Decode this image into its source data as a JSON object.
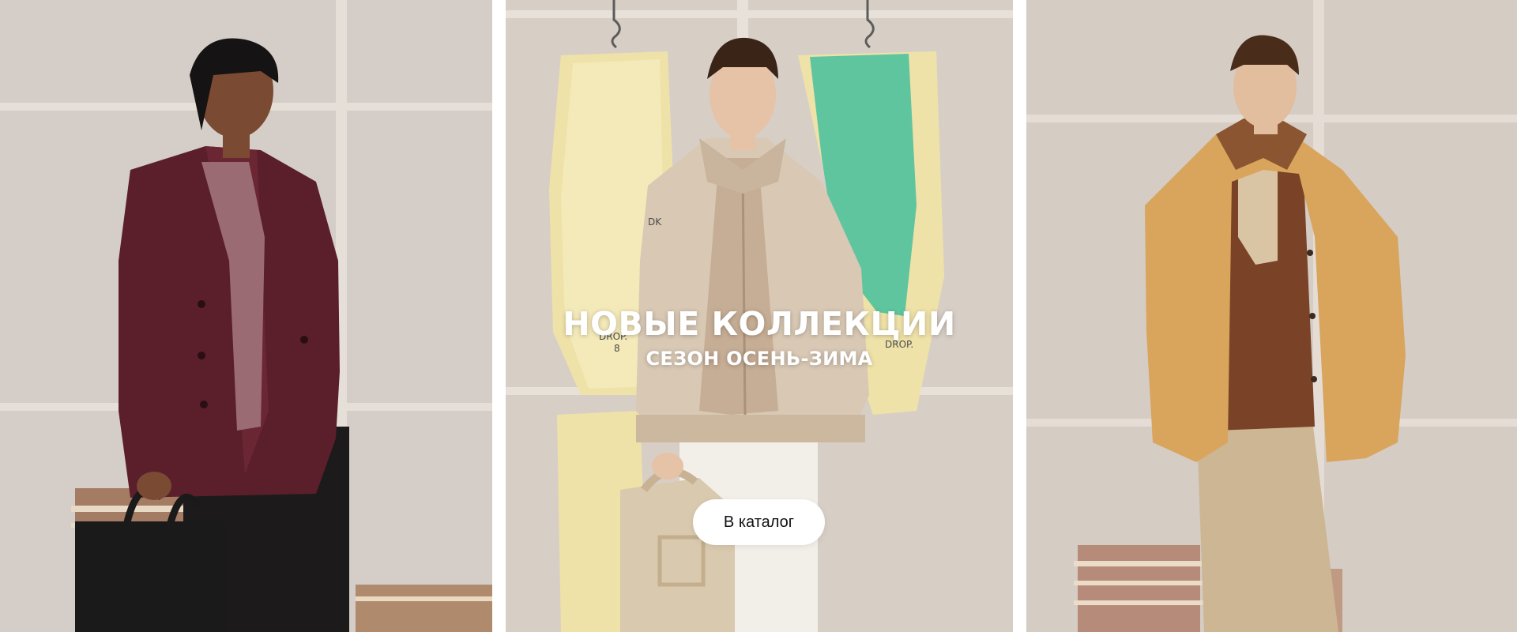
{
  "hero": {
    "title": "НОВЫЕ КОЛЛЕКЦИИ",
    "subtitle": "СЕЗОН ОСЕНЬ-ЗИМА",
    "cta_label": "В каталог"
  },
  "photos": {
    "left": "model-burgundy-peacoat",
    "center": "model-beige-bomber-with-bag",
    "right": "model-camel-shearling-jacket"
  },
  "colors": {
    "wall": "#d9d2cb",
    "burgundy": "#5a1f2b",
    "beige": "#d8c8b4",
    "camel": "#d9a45c",
    "pattern_yellow": "#efe2a8",
    "pattern_green": "#5fc59e"
  }
}
